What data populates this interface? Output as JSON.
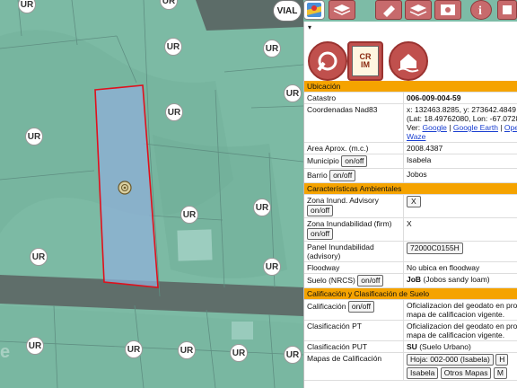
{
  "map": {
    "zone_label": "UR",
    "vial_label": "VIAL"
  },
  "panel": {
    "caret": "▾",
    "crim_top": "CR",
    "crim_bottom": "IM",
    "sections": {
      "ubicacion": "Ubicación",
      "ambientales": "Características Ambientales",
      "calificacion": "Calificación y Clasificación de Suelo"
    },
    "rows": {
      "catastro_label": "Catastro",
      "catastro_value": "006-009-004-59",
      "coord_label": "Coordenadas Nad83",
      "coord_xy": "x: 132463.8285, y: 273642.4849",
      "coord_latlon": "(Lat: 18.49762080, Lon: -67.0728",
      "ver_label": "Ver:",
      "link_google": "Google",
      "link_earth": "Google Earth",
      "link_open": "Ope",
      "link_waze": "Waze",
      "area_label": "Area Aprox. (m.c.)",
      "area_value": "2008.4387",
      "municipio_label": "Municipio",
      "municipio_value": "Isabela",
      "barrio_label": "Barrio",
      "barrio_value": "Jobos",
      "inund_adv_label": "Zona Inund. Advisory",
      "inund_adv_value": "X",
      "inund_firm_label": "Zona Inundabilidad (firm)",
      "inund_firm_value": "X",
      "panel_label_1": "Panel Inundabilidad",
      "panel_label_2": "(advisory)",
      "panel_value": "72000C0155H",
      "floodway_label": "Floodway",
      "floodway_value": "No ubica en floodway",
      "suelo_label": "Suelo (NRCS)",
      "suelo_code": "JoB",
      "suelo_desc": "(Jobos sandy loam)",
      "calif_label": "Calificación",
      "calif_value_1": "Oficializacion del geodato en proc",
      "calif_value_2": "mapa de calificacion vigente.",
      "clasif_pt_label": "Clasificación PT",
      "clasif_pt_value_1": "Oficializacion del geodato en proc",
      "clasif_pt_value_2": "mapa de calificacion vigente.",
      "clasif_put_label": "Clasificación PUT",
      "clasif_put_code": "SU",
      "clasif_put_desc": "(Suelo Urbano)",
      "mapas_label": "Mapas de Calificación",
      "hoja_button": "Hoja: 002-000 (Isabela)",
      "hoja_button_2": "H",
      "isabela_button": "Isabela",
      "otros_button": "Otros Mapas",
      "m_button": "M"
    },
    "onoff": "on/off"
  }
}
